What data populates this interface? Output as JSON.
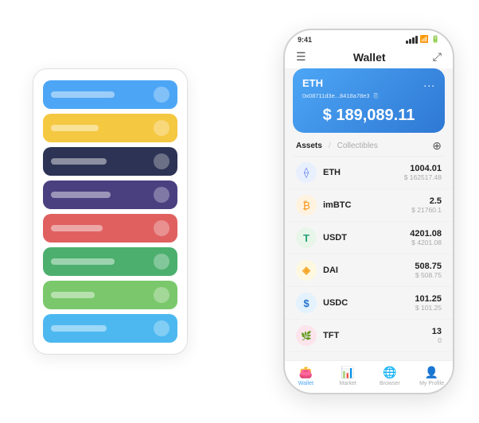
{
  "scene": {
    "card_stack": {
      "cards": [
        {
          "color": "card-blue",
          "label_width": "80px"
        },
        {
          "color": "card-yellow",
          "label_width": "60px"
        },
        {
          "color": "card-dark",
          "label_width": "70px"
        },
        {
          "color": "card-purple",
          "label_width": "75px"
        },
        {
          "color": "card-red",
          "label_width": "65px"
        },
        {
          "color": "card-green",
          "label_width": "80px"
        },
        {
          "color": "card-light-green",
          "label_width": "55px"
        },
        {
          "color": "card-sky",
          "label_width": "70px"
        }
      ]
    },
    "phone": {
      "status_bar": {
        "time": "9:41"
      },
      "header": {
        "menu_icon": "☰",
        "title": "Wallet",
        "expand_icon": "⤢"
      },
      "eth_card": {
        "title": "ETH",
        "dots": "...",
        "address": "0x08711d3e...8418a78e3",
        "copy_icon": "⎘",
        "amount": "$ 189,089.11"
      },
      "assets_section": {
        "tab_active": "Assets",
        "tab_separator": "/",
        "tab_inactive": "Collectibles",
        "add_icon": "⊕"
      },
      "assets": [
        {
          "icon": "⟠",
          "icon_bg": "icon-eth",
          "name": "ETH",
          "amount": "1004.01",
          "usd": "$ 162517.48"
        },
        {
          "icon": "₿",
          "icon_bg": "icon-imbtc",
          "name": "imBTC",
          "amount": "2.5",
          "usd": "$ 21760.1"
        },
        {
          "icon": "₮",
          "icon_bg": "icon-usdt",
          "name": "USDT",
          "amount": "4201.08",
          "usd": "$ 4201.08"
        },
        {
          "icon": "◈",
          "icon_bg": "icon-dai",
          "name": "DAI",
          "amount": "508.75",
          "usd": "$ 508.75"
        },
        {
          "icon": "©",
          "icon_bg": "icon-usdc",
          "name": "USDC",
          "amount": "101.25",
          "usd": "$ 101.25"
        },
        {
          "icon": "🌿",
          "icon_bg": "icon-tft",
          "name": "TFT",
          "amount": "13",
          "usd": "0"
        }
      ],
      "bottom_nav": [
        {
          "icon": "👛",
          "label": "Wallet",
          "active": true
        },
        {
          "icon": "📊",
          "label": "Market",
          "active": false
        },
        {
          "icon": "🌐",
          "label": "Browser",
          "active": false
        },
        {
          "icon": "👤",
          "label": "My Profile",
          "active": false
        }
      ]
    }
  }
}
